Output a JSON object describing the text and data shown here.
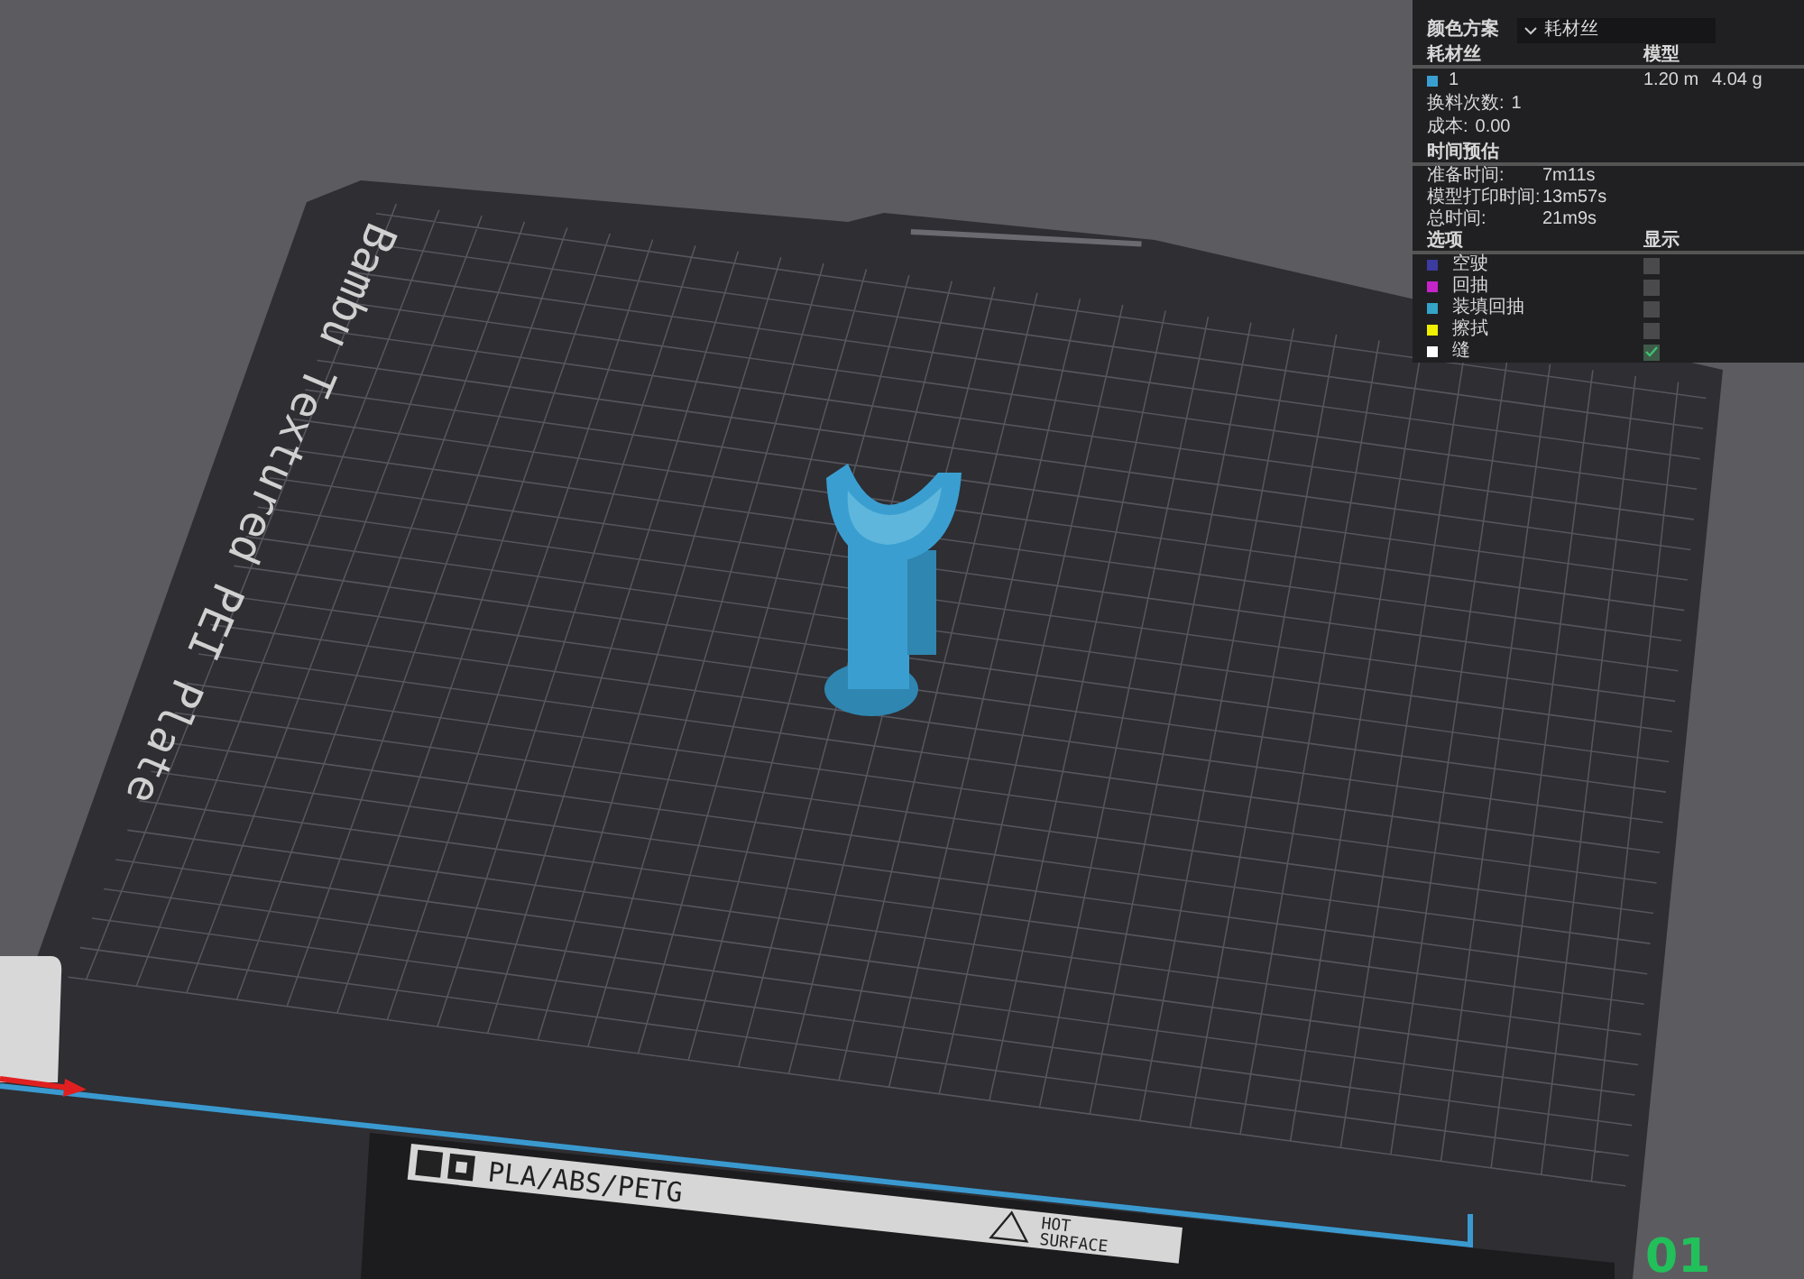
{
  "scheme": {
    "label": "颜色方案",
    "value": "耗材丝"
  },
  "filament": {
    "columns": [
      "耗材丝",
      "模型"
    ],
    "rows": [
      {
        "color": "#3a9fd0",
        "name": "1",
        "length": "1.20 m",
        "weight": "4.04 g"
      }
    ],
    "changes": {
      "label": "换料次数:",
      "value": "1"
    },
    "cost": {
      "label": "成本:",
      "value": "0.00"
    }
  },
  "time": {
    "title": "时间预估",
    "rows": [
      {
        "label": "准备时间:",
        "value": "7m11s"
      },
      {
        "label": "模型打印时间:",
        "value": "13m57s"
      },
      {
        "label": "总时间:",
        "value": "21m9s"
      }
    ]
  },
  "options": {
    "columns": [
      "选项",
      "显示"
    ],
    "items": [
      {
        "label": "空驶",
        "color": "#3b3ba0",
        "checked": false
      },
      {
        "label": "回抽",
        "color": "#c424c8",
        "checked": false
      },
      {
        "label": "装填回抽",
        "color": "#34a4c8",
        "checked": false
      },
      {
        "label": "擦拭",
        "color": "#f0f000",
        "checked": false
      },
      {
        "label": "缝",
        "color": "#ffffff",
        "checked": true
      }
    ]
  },
  "plate": {
    "name": "Bambu Textured PEI Plate",
    "material_label": "PLA/ABS/PETG",
    "warning_lines": [
      "HOT",
      "SURFACE"
    ],
    "number": "01"
  }
}
